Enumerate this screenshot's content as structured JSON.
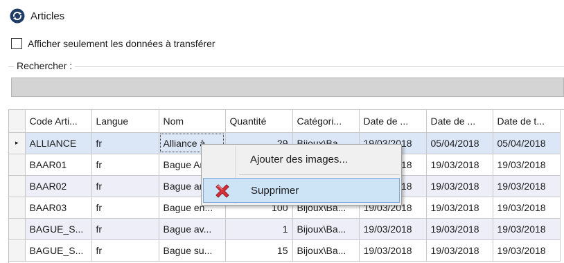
{
  "header": {
    "title": "Articles",
    "icon": "refresh-icon"
  },
  "filter": {
    "label": "Afficher seulement les données à transférer",
    "checked": false
  },
  "search": {
    "legend": "Rechercher :",
    "value": ""
  },
  "grid": {
    "columns": [
      "Code Arti...",
      "Langue",
      "Nom",
      "Quantité",
      "Catégori...",
      "Date de ...",
      "Date de ...",
      "Date de t..."
    ],
    "rows": [
      {
        "indicator": "▸",
        "cells": [
          "ALLIANCE",
          "fr",
          "Alliance à",
          "29",
          "Bijoux\\Ba...",
          "19/03/2018",
          "05/04/2018",
          "05/04/2018"
        ]
      },
      {
        "indicator": "",
        "cells": [
          "BAAR01",
          "fr",
          "Bague Ar",
          "",
          "",
          "19/03/2018",
          "19/03/2018",
          "19/03/2018"
        ]
      },
      {
        "indicator": "",
        "cells": [
          "BAAR02",
          "fr",
          "Bague ar",
          "",
          "",
          "19/03/2018",
          "19/03/2018",
          "19/03/2018"
        ]
      },
      {
        "indicator": "",
        "cells": [
          "BAAR03",
          "fr",
          "Bague en...",
          "100",
          "Bijoux\\Ba...",
          "19/03/2018",
          "19/03/2018",
          "19/03/2018"
        ]
      },
      {
        "indicator": "",
        "cells": [
          "BAGUE_S...",
          "fr",
          "Bague av...",
          "1",
          "Bijoux\\Ba...",
          "19/03/2018",
          "19/03/2018",
          "19/03/2018"
        ]
      },
      {
        "indicator": "",
        "cells": [
          "BAGUE_S...",
          "fr",
          "Bague su...",
          "15",
          "Bijoux\\Ba...",
          "19/03/2018",
          "19/03/2018",
          "19/03/2018"
        ]
      }
    ]
  },
  "context_menu": {
    "items": [
      {
        "label": "Ajouter des images...",
        "icon": ""
      },
      {
        "label": "Supprimer",
        "icon": "delete-x-icon"
      }
    ]
  },
  "colors": {
    "selected_row": "#dbe6f6",
    "alt_row": "#edeef7",
    "menu_highlight": "#cde4f7",
    "delete_red": "#d9303a"
  }
}
